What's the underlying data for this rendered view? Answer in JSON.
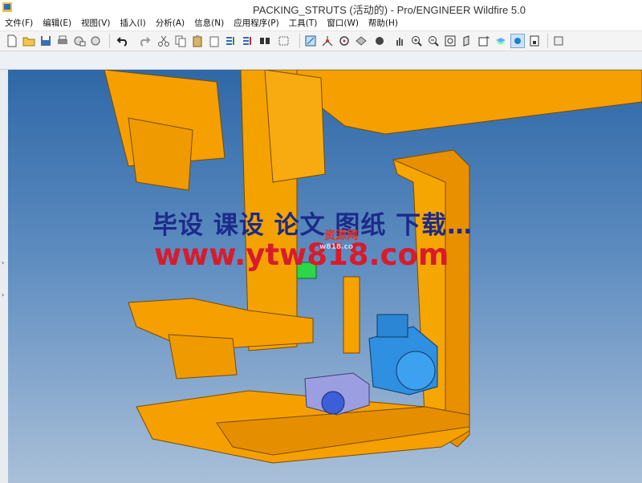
{
  "window": {
    "title": "PACKING_STRUTS (活动的) - Pro/ENGINEER Wildfire 5.0"
  },
  "menu": [
    {
      "label": "文件(F)",
      "name": "menu-file"
    },
    {
      "label": "编辑(E)",
      "name": "menu-edit"
    },
    {
      "label": "视图(V)",
      "name": "menu-view"
    },
    {
      "label": "插入(I)",
      "name": "menu-insert"
    },
    {
      "label": "分析(A)",
      "name": "menu-analysis"
    },
    {
      "label": "信息(N)",
      "name": "menu-info"
    },
    {
      "label": "应用程序(P)",
      "name": "menu-applications"
    },
    {
      "label": "工具(T)",
      "name": "menu-tools"
    },
    {
      "label": "窗口(W)",
      "name": "menu-window"
    },
    {
      "label": "帮助(H)",
      "name": "menu-help"
    }
  ],
  "toolbar": {
    "icons": [
      "new-icon",
      "open-icon",
      "save-icon",
      "print-icon",
      "send-mail-icon",
      "undo-icon",
      "redo-icon",
      "cut-icon",
      "copy-icon",
      "paste-icon",
      "regenerate-icon",
      "find-icon",
      "select-box-icon",
      "sketch-icon",
      "datum-axis-icon",
      "repaint-icon",
      "shading-icon",
      "pan-icon",
      "zoom-in-icon",
      "zoom-out-icon",
      "refit-icon",
      "orient-icon",
      "saved-views-icon",
      "layers-icon",
      "display-style-icon",
      "spin-center-icon"
    ]
  },
  "watermark": {
    "line1": "毕设 课设 论文 图纸 下载…",
    "line2": "www.ytw818.com",
    "logo": "资源网",
    "logo_sub": "w818.co"
  },
  "colors": {
    "viewport_top": "#2f68a7",
    "viewport_bottom": "#a9bfd8",
    "part": "#f5a000",
    "motor": "#2f8fe0",
    "gearbox": "#8e8fd6",
    "watermark_blue": "#1c2a8a",
    "watermark_red": "#d81b2c"
  }
}
